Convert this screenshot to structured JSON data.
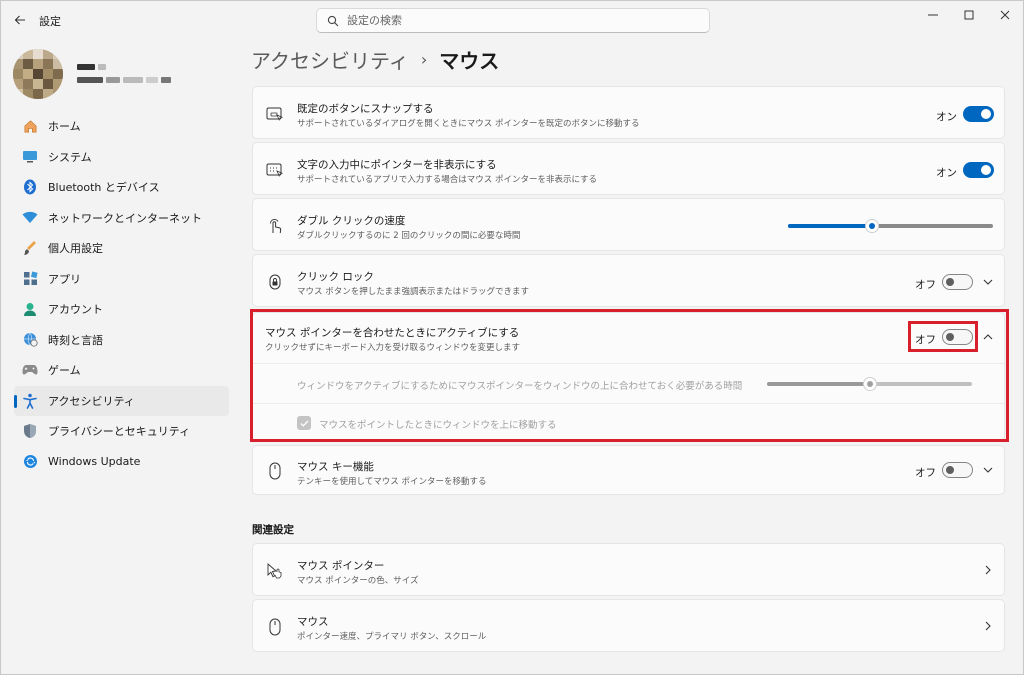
{
  "window": {
    "app_title": "設定",
    "search_placeholder": "設定の検索"
  },
  "profile": {
    "name": "",
    "email": ""
  },
  "sidebar": {
    "items": [
      {
        "label": "ホーム",
        "icon": "home-icon"
      },
      {
        "label": "システム",
        "icon": "system-icon"
      },
      {
        "label": "Bluetooth とデバイス",
        "icon": "bluetooth-icon"
      },
      {
        "label": "ネットワークとインターネット",
        "icon": "wifi-icon"
      },
      {
        "label": "個人用設定",
        "icon": "brush-icon"
      },
      {
        "label": "アプリ",
        "icon": "apps-icon"
      },
      {
        "label": "アカウント",
        "icon": "account-icon"
      },
      {
        "label": "時刻と言語",
        "icon": "globe-clock-icon"
      },
      {
        "label": "ゲーム",
        "icon": "gamepad-icon"
      },
      {
        "label": "アクセシビリティ",
        "icon": "accessibility-icon",
        "active": true
      },
      {
        "label": "プライバシーとセキュリティ",
        "icon": "shield-icon"
      },
      {
        "label": "Windows Update",
        "icon": "update-icon"
      }
    ]
  },
  "breadcrumb": {
    "parent": "アクセシビリティ",
    "separator": "›",
    "current": "マウス"
  },
  "settings": {
    "snap": {
      "title": "既定のボタンにスナップする",
      "desc": "サポートされているダイアログを開くときにマウス ポインターを既定のボタンに移動する",
      "state_label": "オン",
      "on": true
    },
    "hide_pointer": {
      "title": "文字の入力中にポインターを非表示にする",
      "desc": "サポートされているアプリで入力する場合はマウス ポインターを非表示にする",
      "state_label": "オン",
      "on": true
    },
    "double_click": {
      "title": "ダブル クリックの速度",
      "desc": "ダブルクリックするのに 2 回のクリックの間に必要な時間",
      "level": 0.41
    },
    "click_lock": {
      "title": "クリック ロック",
      "desc": "マウス ボタンを押したまま強調表示またはドラッグできます",
      "state_label": "オフ",
      "on": false
    },
    "active_hover": {
      "title": "マウス ポインターを合わせたときにアクティブにする",
      "desc": "クリックせずにキーボード入力を受け取るウィンドウを変更します",
      "state_label": "オフ",
      "on": false,
      "delay_label": "ウィンドウをアクティブにするためにマウスポインターをウィンドウの上に合わせておく必要がある時間",
      "delay_level": 0.5,
      "raise_label": "マウスをポイントしたときにウィンドウを上に移動する",
      "raise_checked": true
    },
    "mouse_keys": {
      "title": "マウス キー機能",
      "desc": "テンキーを使用してマウス ポインターを移動する",
      "state_label": "オフ",
      "on": false
    }
  },
  "related": {
    "heading": "関連設定",
    "items": [
      {
        "title": "マウス ポインター",
        "desc": "マウス ポインターの色、サイズ",
        "icon": "pointer-icon"
      },
      {
        "title": "マウス",
        "desc": "ポインター速度、プライマリ ボタン、スクロール",
        "icon": "mouse-icon"
      }
    ]
  },
  "colors": {
    "accent": "#0067c0",
    "highlight": "#d8202c"
  }
}
